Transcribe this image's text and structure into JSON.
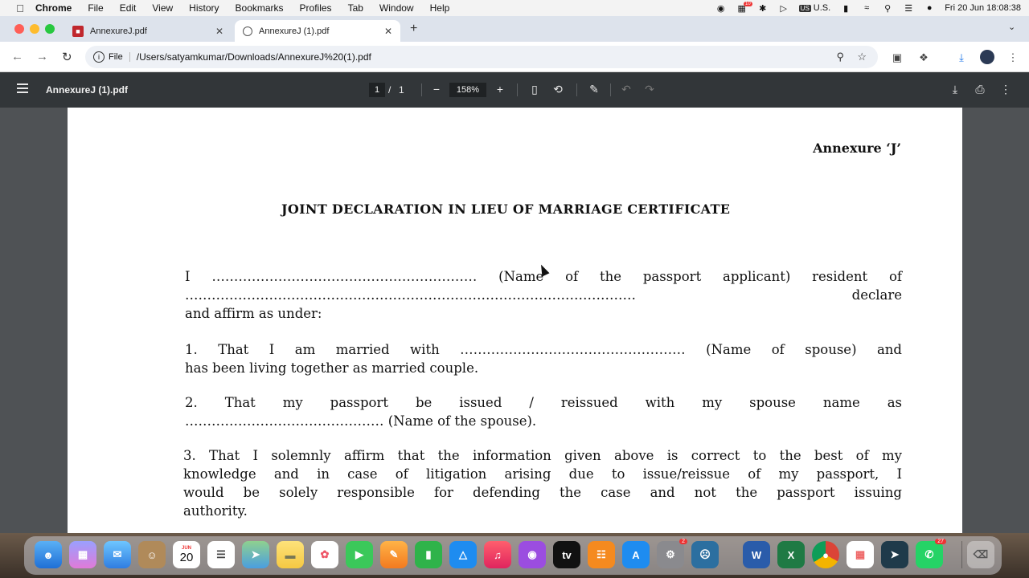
{
  "menubar": {
    "app": "Chrome",
    "items": [
      "File",
      "Edit",
      "View",
      "History",
      "Bookmarks",
      "Profiles",
      "Tab",
      "Window",
      "Help"
    ],
    "input_source": "U.S.",
    "input_badge": "US",
    "clock": "Fri 20 Jun  18:08:38",
    "status_badge": "10"
  },
  "tabs": [
    {
      "title": "AnnexureJ.pdf",
      "active": false
    },
    {
      "title": "AnnexureJ (1).pdf",
      "active": true
    }
  ],
  "address": {
    "scheme_chip": "File",
    "url": "/Users/satyamkumar/Downloads/AnnexureJ%20(1).pdf"
  },
  "pdf_toolbar": {
    "title": "AnnexureJ (1).pdf",
    "page_current": "1",
    "page_sep": "/",
    "page_total": "1",
    "zoom": "158%"
  },
  "document": {
    "annexure": "Annexure ‘J’",
    "title": "JOINT DECLARATION IN LIEU OF MARRIAGE CERTIFICATE",
    "intro_line1": "I …………………………………………………… (Name of the passport applicant) resident of",
    "intro_line2": "………………………………………………………………………………………… declare",
    "intro_line3": "and affirm as under:",
    "p1_line1": "1.  That I am married with …………………………………………… (Name of spouse) and",
    "p1_line2": "has been living together as married couple.",
    "p2_line1": "2.   That my passport be issued / reissued with my spouse name as",
    "p2_line2": "……………………………………… (Name of the spouse).",
    "p3_line1": "3.  That I solemnly affirm that the information given above is correct to the best of my",
    "p3_line2": "knowledge and in case of litigation arising due to issue/reissue of my passport, I",
    "p3_line3": "would be solely responsible for defending the case and not the passport issuing",
    "p3_line4": "authority."
  },
  "dock": {
    "calendar_month": "JUN",
    "calendar_day": "20",
    "badges": {
      "settings": "2",
      "whatsapp": "27"
    }
  },
  "colors": {
    "pdf_toolbar": "#323639",
    "viewer_bg": "#4f5255",
    "tabstrip": "#dde3ec",
    "accent_blue": "#1a73e8"
  }
}
